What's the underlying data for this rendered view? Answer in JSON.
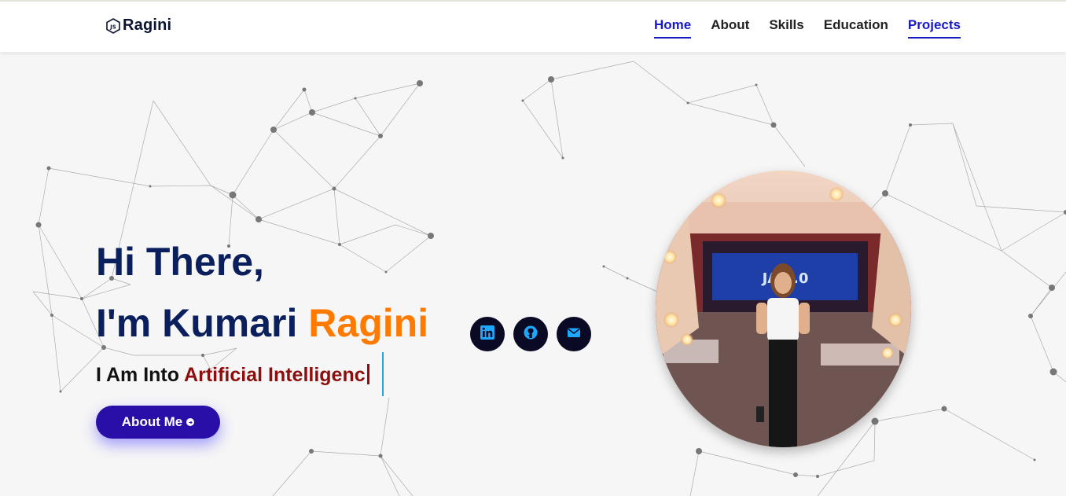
{
  "header": {
    "logo_text": "Ragini",
    "nav": [
      {
        "label": "Home",
        "active": true
      },
      {
        "label": "About",
        "active": false
      },
      {
        "label": "Skills",
        "active": false
      },
      {
        "label": "Education",
        "active": false
      },
      {
        "label": "Projects",
        "active": true
      }
    ]
  },
  "hero": {
    "greeting": "Hi There,",
    "intro_prefix": "I'm Kumari ",
    "name_accent": "Ragini",
    "tagline_prefix": "I Am Into ",
    "tagline_typed": "Artificial Intelligenc",
    "button_label": "About Me",
    "photo_screen_text": "JA    3.0"
  },
  "social": [
    {
      "name": "linkedin-icon"
    },
    {
      "name": "github-icon"
    },
    {
      "name": "mail-icon"
    }
  ],
  "colors": {
    "nav_active": "#1a1ac4",
    "heading": "#0b1f5c",
    "accent": "#ff7a00",
    "typed": "#8b0f0f",
    "button": "#2a0ea8",
    "social_bg": "#0a0a24",
    "social_icon": "#1ea7ff"
  }
}
